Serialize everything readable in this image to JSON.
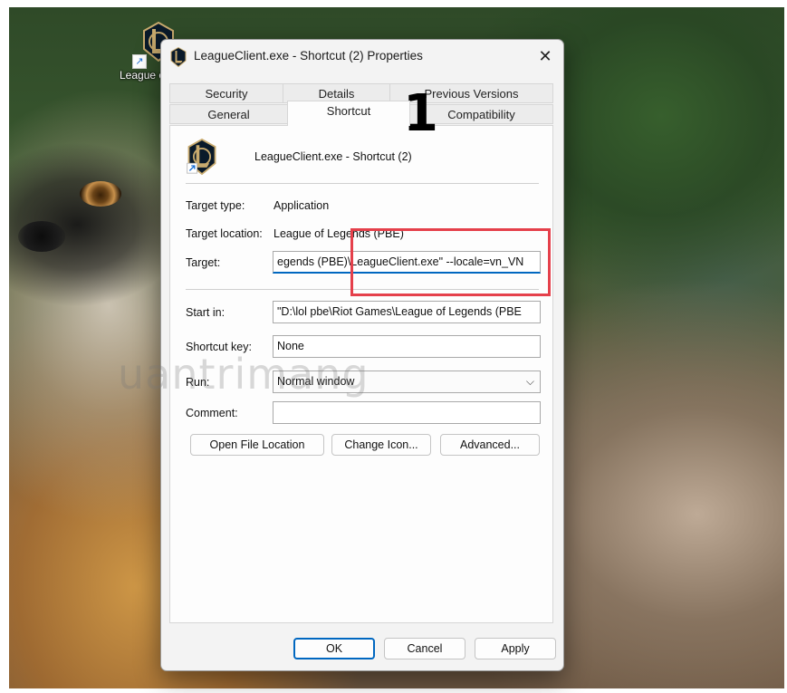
{
  "desktop": {
    "icon_label": "League of Legends (PBE) - Shortcut",
    "icon": "league-of-legends-icon"
  },
  "dialog": {
    "title": "LeagueClient.exe - Shortcut (2) Properties",
    "close_glyph": "✕",
    "tabs_row1": [
      {
        "label": "Security"
      },
      {
        "label": "Details"
      },
      {
        "label": "Previous Versions"
      }
    ],
    "tabs_row2": [
      {
        "label": "General"
      },
      {
        "label": "Shortcut",
        "active": true
      },
      {
        "label": "Compatibility"
      }
    ],
    "shortcut_name": "LeagueClient.exe - Shortcut (2)",
    "fields": {
      "target_type_label": "Target type:",
      "target_type_value": "Application",
      "target_location_label": "Target location:",
      "target_location_value": "League of Legends (PBE)",
      "target_label": "Target:",
      "target_value": "egends (PBE)\\LeagueClient.exe\" --locale=vn_VN",
      "start_in_label": "Start in:",
      "start_in_value": "\"D:\\lol pbe\\Riot Games\\League of Legends (PBE",
      "shortcut_key_label": "Shortcut key:",
      "shortcut_key_value": "None",
      "run_label": "Run:",
      "run_value": "Normal window",
      "comment_label": "Comment:",
      "comment_value": ""
    },
    "buttons": {
      "open_file_location": "Open File Location",
      "change_icon": "Change Icon...",
      "advanced": "Advanced...",
      "ok": "OK",
      "cancel": "Cancel",
      "apply": "Apply"
    }
  },
  "annotations": {
    "step_number": "1",
    "highlight_color": "#e5404b",
    "watermark": "uantrimang"
  },
  "colors": {
    "accent": "#0067c0",
    "dialog_bg": "#f3f3f3"
  }
}
